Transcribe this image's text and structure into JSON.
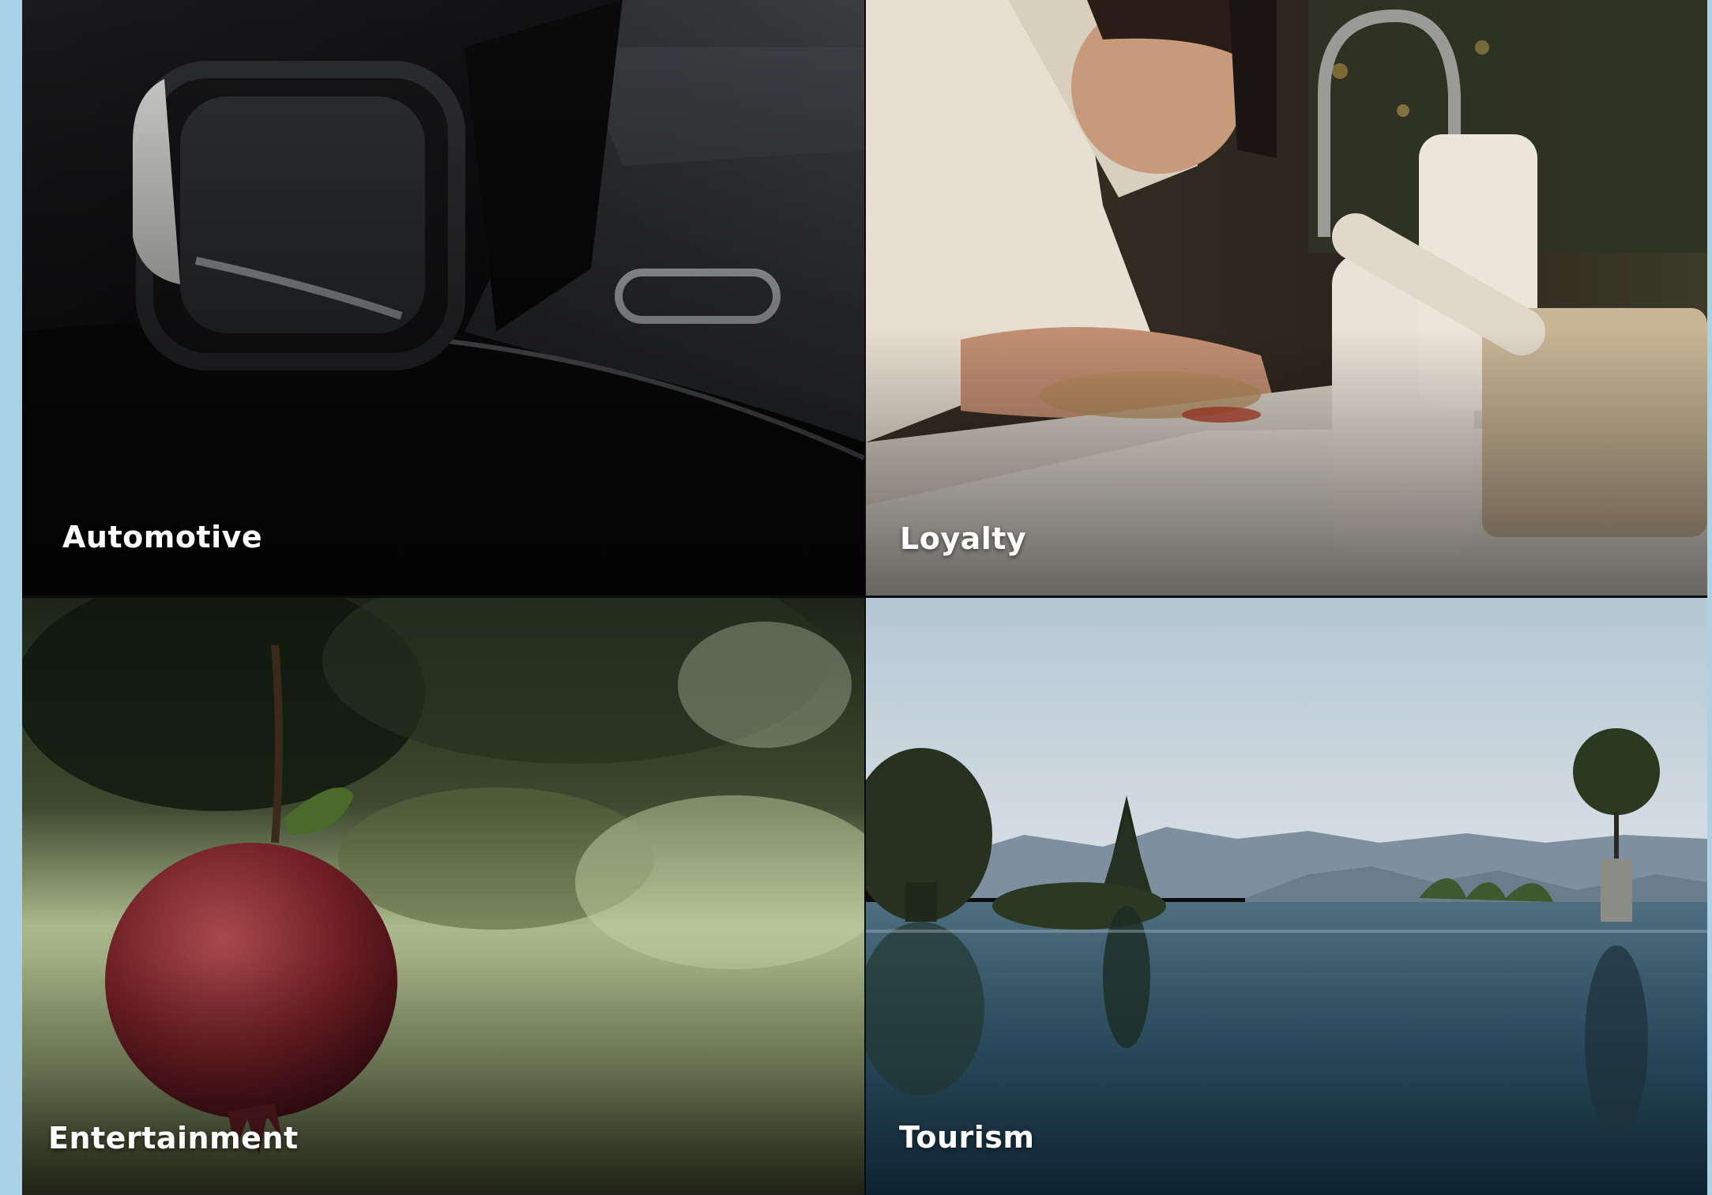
{
  "tiles": [
    {
      "label": "Automotive",
      "image": "car-side-mirror"
    },
    {
      "label": "Loyalty",
      "image": "chef-plating-dish"
    },
    {
      "label": "Entertainment",
      "image": "pomegranate-on-branch"
    },
    {
      "label": "Tourism",
      "image": "infinity-pool-sea-view"
    }
  ],
  "colors": {
    "page_background": "#a9d2e6",
    "label_text": "#ffffff"
  }
}
